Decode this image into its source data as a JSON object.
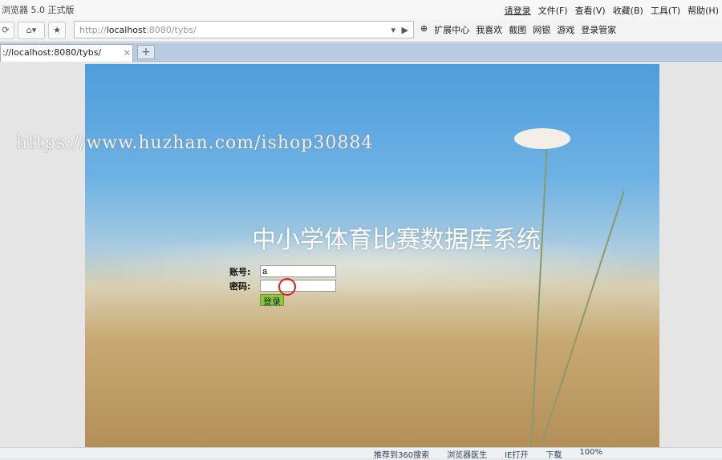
{
  "window": {
    "title": "浏览器 5.0 正式版",
    "login": "请登录",
    "menus": [
      "文件(F)",
      "查看(V)",
      "收藏(B)",
      "工具(T)",
      "帮助(H)"
    ]
  },
  "navbar": {
    "url_prefix": "http://",
    "url_host": "localhost",
    "url_rest": ":8080/tybs/",
    "tools": [
      "扩展中心",
      "我喜欢",
      "截图",
      "网银",
      "游戏",
      "登录管家"
    ]
  },
  "tab": {
    "label": "://localhost:8080/tybs/",
    "close": "×",
    "new_tab": "+"
  },
  "page": {
    "watermark": "https://www.huzhan.com/ishop30884",
    "title": "中小学体育比赛数据库系统",
    "account_label": "账号:",
    "account_value": "a",
    "password_label": "密码:",
    "password_value": "",
    "login_button": "登录"
  },
  "statusbar": {
    "items": [
      "推荐到360搜索",
      "浏览器医生",
      "IE打开",
      "下载",
      "100%"
    ]
  }
}
